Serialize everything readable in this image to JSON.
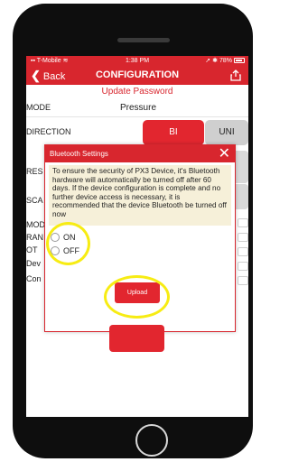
{
  "status_bar": {
    "carrier": "T-Mobile",
    "time": "1:38 PM",
    "battery": "78%"
  },
  "nav": {
    "back_label": "Back",
    "title": "CONFIGURATION"
  },
  "update_password": "Update Password",
  "form": {
    "mode_label": "MODE",
    "mode_value": "Pressure",
    "direction_label": "DIRECTION",
    "direction_options": [
      "BI",
      "UNI"
    ],
    "direction_selected": "BI",
    "partial_labels": [
      "RES",
      "SCA",
      "MOD",
      "RAN",
      "OT",
      "Dev",
      "Con"
    ]
  },
  "dialog": {
    "title": "Bluetooth Settings",
    "message": "To ensure the security of PX3 Device, it's Bluetooth hardware will automatically be turned off after 60 days. If the device configuration  is complete and no further device access is necessary, it is recommended that the device Bluetooth be turned off now",
    "options": [
      "ON",
      "OFF"
    ],
    "upload_label": "Upload"
  },
  "colors": {
    "accent": "#d8262e",
    "highlight": "#f7ec13",
    "notice_bg": "#f6f0d9"
  },
  "icons": {
    "share": "share-icon",
    "close": "close-icon",
    "back": "chevron-left-icon"
  }
}
